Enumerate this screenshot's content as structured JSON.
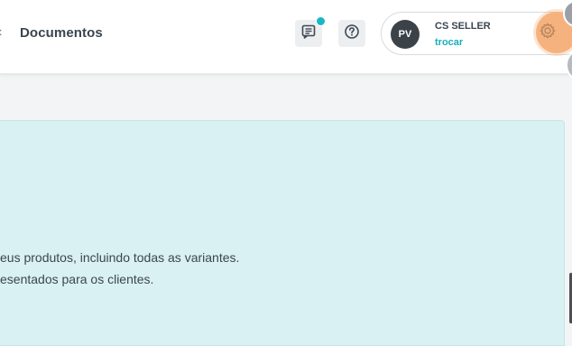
{
  "header": {
    "back_glyph": "‹",
    "nav_title": "Documentos",
    "messages_icon": "message-icon",
    "help_icon": "help-circle-icon",
    "user": {
      "initials": "PV",
      "name": "CS SELLER",
      "switch_label": "trocar"
    },
    "settings_icon": "gear-icon"
  },
  "info_card": {
    "line1": "eus produtos, incluindo todas as variantes.",
    "line2": "esentados para os clientes."
  },
  "colors": {
    "accent": "#1ab7c4",
    "card_background": "#d9f1f2",
    "gear_highlight": "#f6b27e",
    "avatar_background": "#3b4248"
  }
}
